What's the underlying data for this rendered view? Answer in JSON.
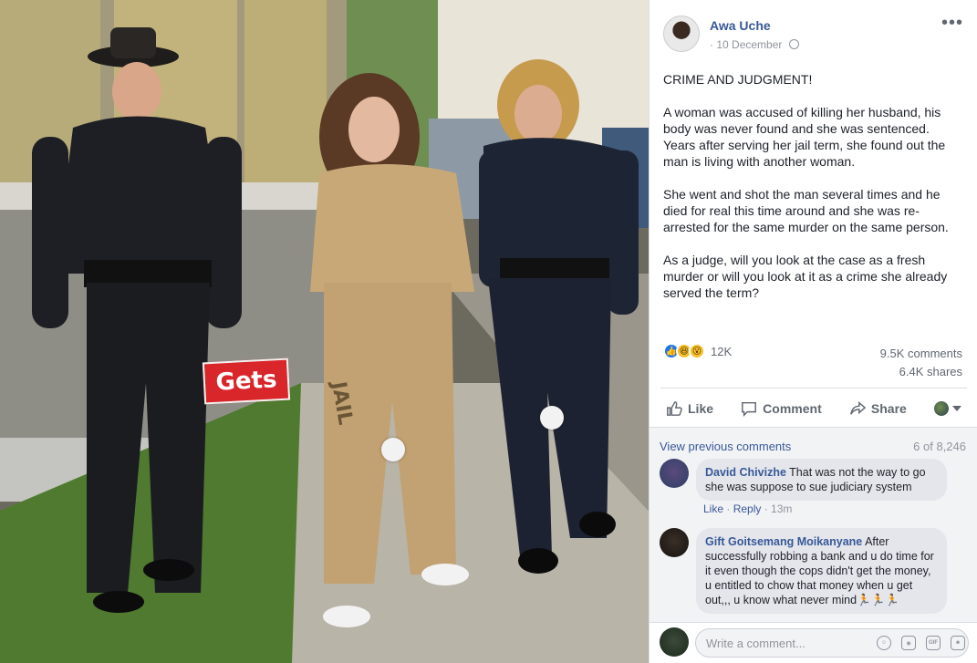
{
  "photo": {
    "sticker_text": "Gets",
    "prison_label": "JAIL"
  },
  "post": {
    "author": "Awa Uche",
    "date": "10 December",
    "date_prefix": "·",
    "more_icon": "ellipsis-icon",
    "privacy_icon": "globe-icon",
    "title": "CRIME AND JUDGMENT!",
    "paragraphs": [
      "A woman was accused of killing her husband, his body was never found and she was sentenced. Years after serving her jail term, she found out the man is living with another woman.",
      "She went and shot the man several times and he died for real this time around and she was re-arrested for the same murder on the same person.",
      "As a judge, will you look at the case as a fresh murder or will you look at it as a crime she already served the term?"
    ]
  },
  "reactions": {
    "icons": [
      "like-icon",
      "haha-icon",
      "wow-icon"
    ],
    "count": "12K",
    "comments": "9.5K comments",
    "shares": "6.4K shares"
  },
  "actions": {
    "like": "Like",
    "comment": "Comment",
    "share": "Share"
  },
  "comments": {
    "view_previous": "View previous comments",
    "count": "6 of 8,246",
    "items": [
      {
        "name": "David Chivizhe",
        "text": "That was not the way to go she was suppose to sue judiciary system",
        "like": "Like",
        "reply": "Reply",
        "time": "13m"
      },
      {
        "name": "Gift Goitsemang Moikanyane",
        "text": "After successfully robbing a bank and u do time for it even though the cops didn't get the money, u entitled to chow that money when u get out,,, u know what never mind🏃🏃🏃"
      }
    ]
  },
  "composer": {
    "placeholder": "Write a comment...",
    "icons": [
      "emoji-icon",
      "camera-icon",
      "gif-icon",
      "sticker-icon"
    ]
  },
  "colors": {
    "link": "#385898",
    "meta": "#90949c",
    "like_blue": "#1877f2",
    "sticker_red": "#d9262a"
  }
}
